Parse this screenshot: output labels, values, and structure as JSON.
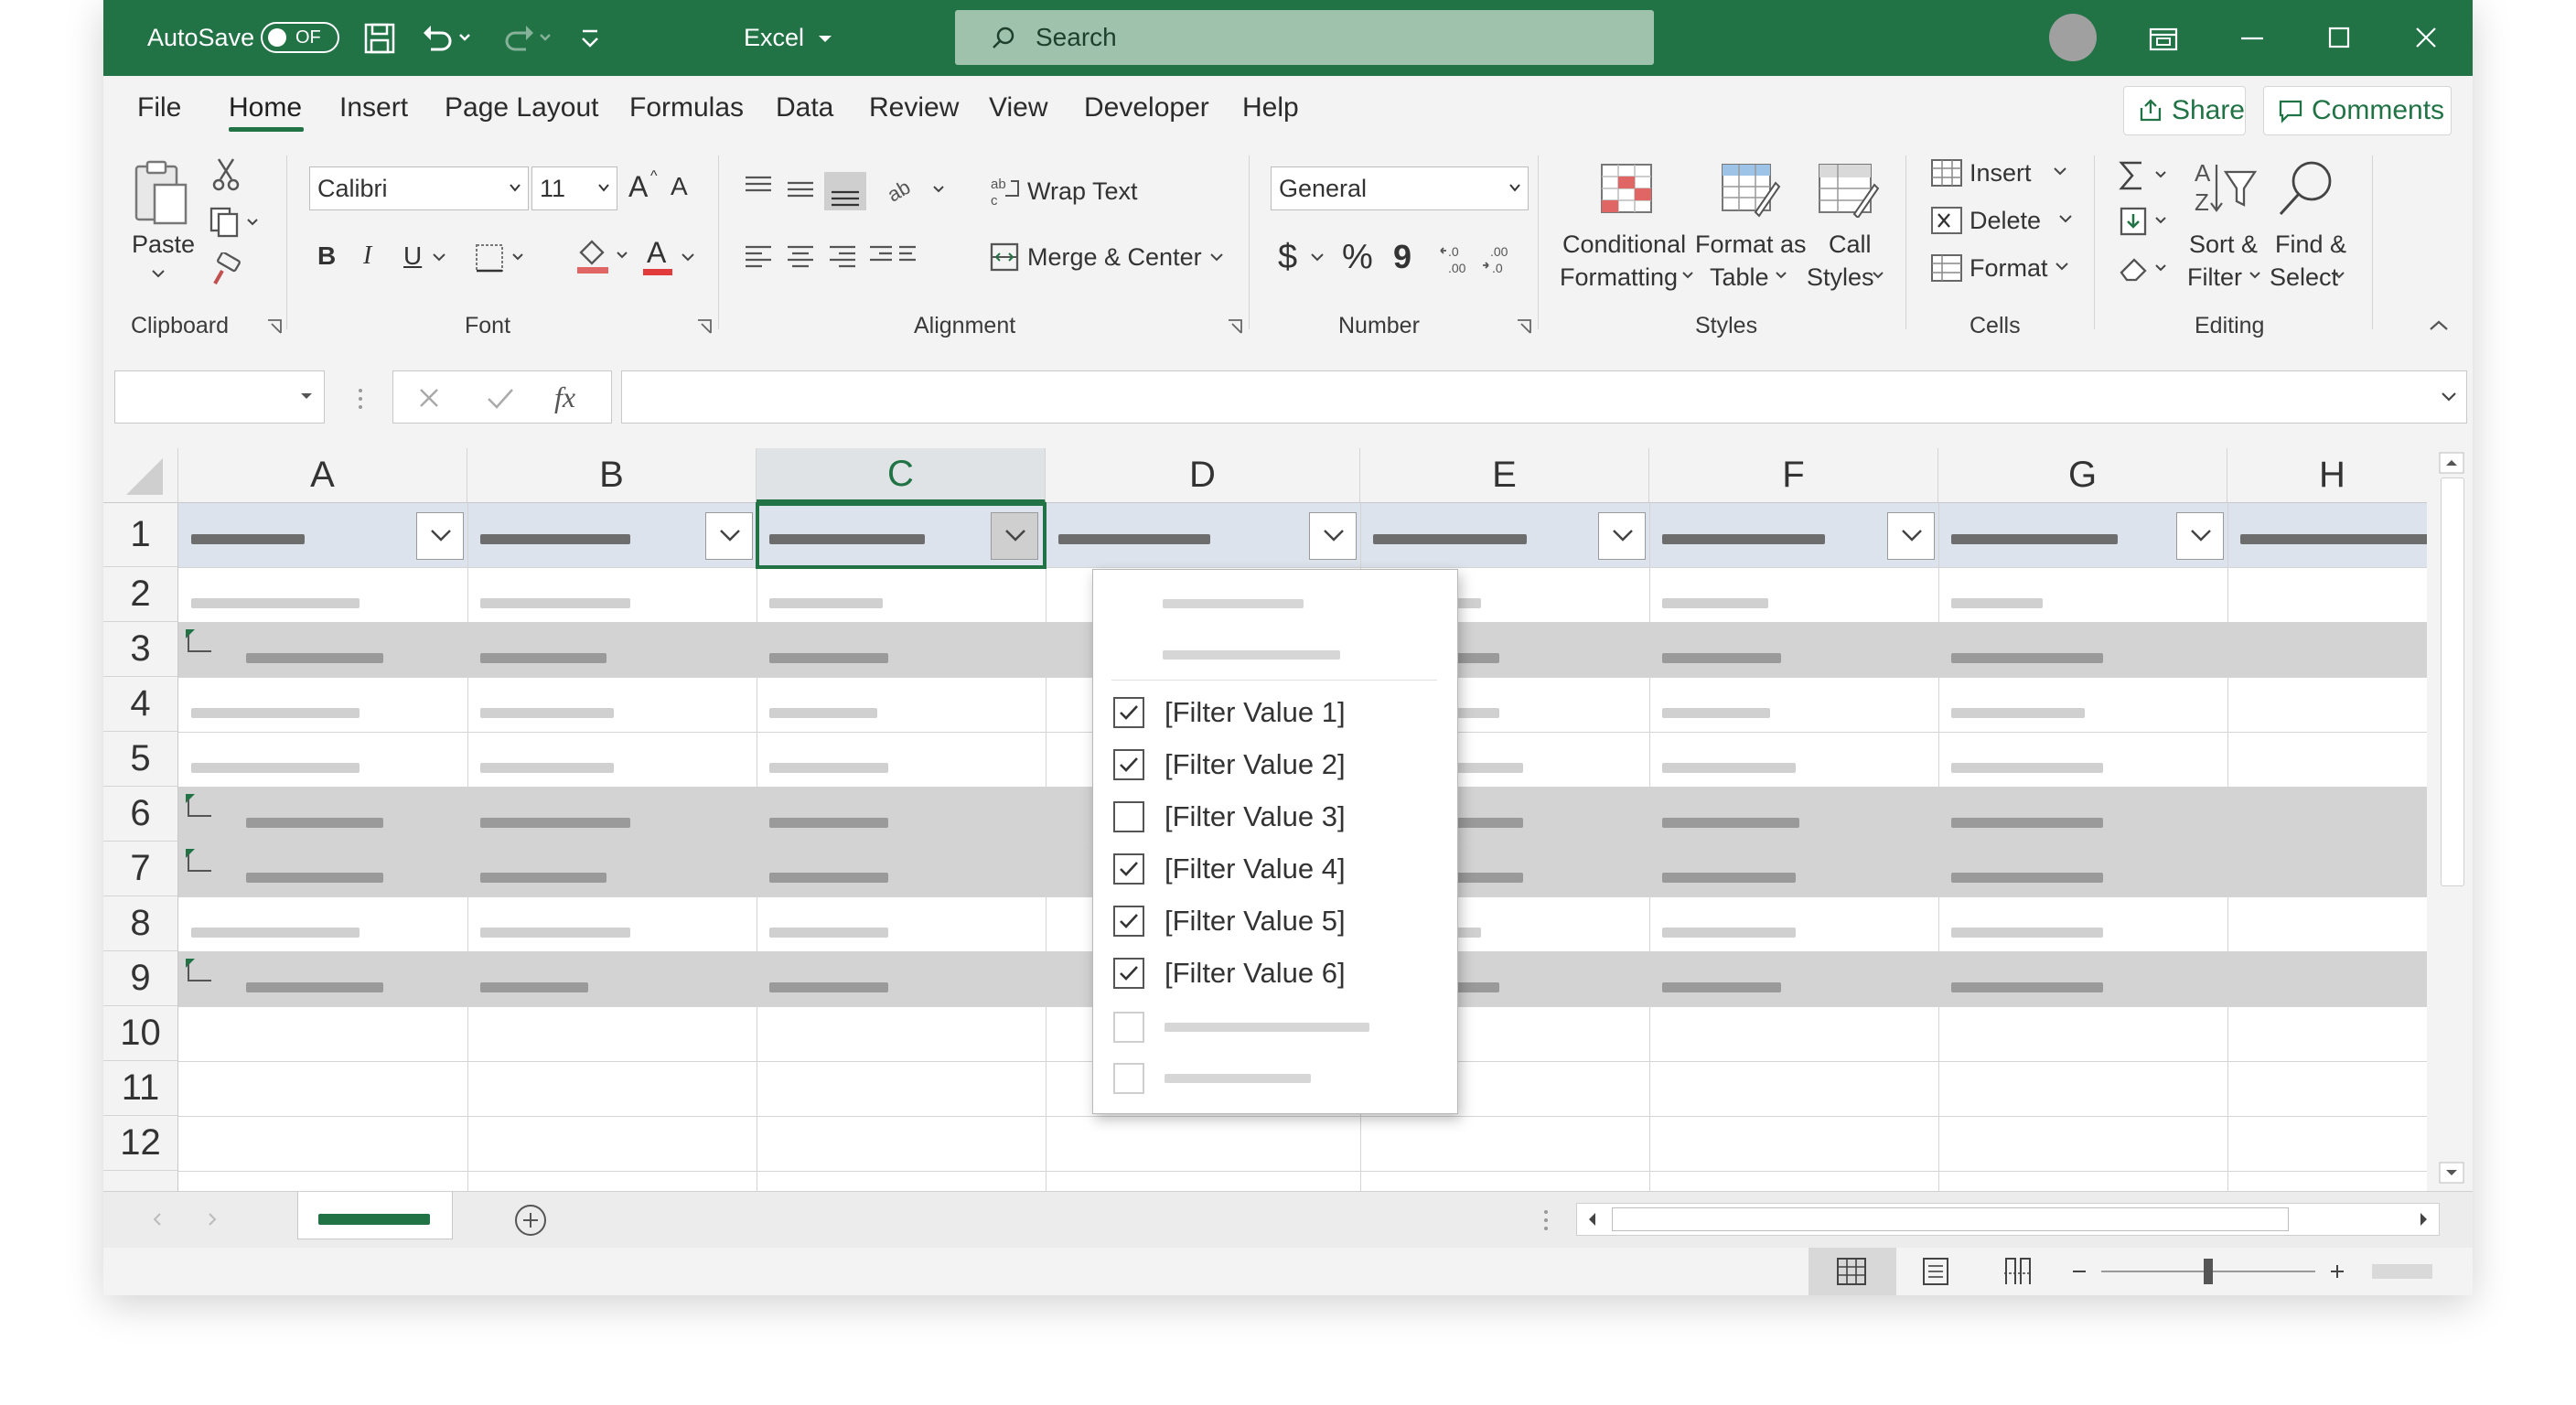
{
  "titlebar": {
    "autosave_label": "AutoSave",
    "autosave_state": "OF",
    "app_name": "Excel",
    "search_placeholder": "Search"
  },
  "tabs": [
    "File",
    "Home",
    "Insert",
    "Page Layout",
    "Formulas",
    "Data",
    "Review",
    "View",
    "Developer",
    "Help"
  ],
  "active_tab": "Home",
  "share_label": "Share",
  "comments_label": "Comments",
  "ribbon": {
    "clipboard": {
      "paste": "Paste",
      "group": "Clipboard"
    },
    "font": {
      "name": "Calibri",
      "size": "11",
      "bold": "B",
      "italic": "I",
      "underline": "U",
      "grow": "A",
      "shrink": "A",
      "color_letter": "A",
      "group": "Font"
    },
    "alignment": {
      "wrap": "Wrap Text",
      "merge": "Merge & Center",
      "group": "Alignment"
    },
    "number": {
      "format": "General",
      "currency": "$",
      "percent": "%",
      "comma": "9",
      "group": "Number"
    },
    "styles": {
      "cond1": "Conditional",
      "cond2": "Formatting",
      "fmt1": "Format as",
      "fmt2": "Table",
      "cell1": "Call",
      "cell2": "Styles",
      "group": "Styles"
    },
    "cells": {
      "insert": "Insert",
      "delete": "Delete",
      "format": "Format",
      "group": "Cells"
    },
    "editing": {
      "sort1": "Sort &",
      "sort2": "Filter",
      "find1": "Find &",
      "find2": "Select",
      "group": "Editing"
    }
  },
  "formula_bar": {
    "fx": "fx"
  },
  "columns": [
    "A",
    "B",
    "C",
    "D",
    "E",
    "F",
    "G",
    "H"
  ],
  "selected_column": "C",
  "rows": [
    "1",
    "2",
    "3",
    "4",
    "5",
    "6",
    "7",
    "8",
    "9",
    "10",
    "11",
    "12"
  ],
  "filter_values": [
    {
      "label": "[Filter Value 1]",
      "checked": true
    },
    {
      "label": "[Filter Value 2]",
      "checked": true
    },
    {
      "label": "[Filter Value 3]",
      "checked": false
    },
    {
      "label": "[Filter Value 4]",
      "checked": true
    },
    {
      "label": "[Filter Value 5]",
      "checked": true
    },
    {
      "label": "[Filter Value 6]",
      "checked": true
    }
  ],
  "colors": {
    "accent": "#217346",
    "row_shade": "#d3d3d3",
    "header_row": "#dde3ec",
    "placeholder_bar": "#c9c9c9",
    "placeholder_dark": "#9a9a9a"
  },
  "icons": [
    "save-icon",
    "undo-icon",
    "redo-icon",
    "search-icon",
    "restore-icon",
    "minimize-icon",
    "maximize-icon",
    "close-icon",
    "paste-icon",
    "cut-icon",
    "copy-icon",
    "format-painter-icon",
    "filter-dropdown-icon",
    "checkbox-icon",
    "add-sheet-icon",
    "normal-view-icon",
    "page-layout-icon",
    "page-break-icon",
    "zoom-minus-icon",
    "zoom-plus-icon"
  ]
}
